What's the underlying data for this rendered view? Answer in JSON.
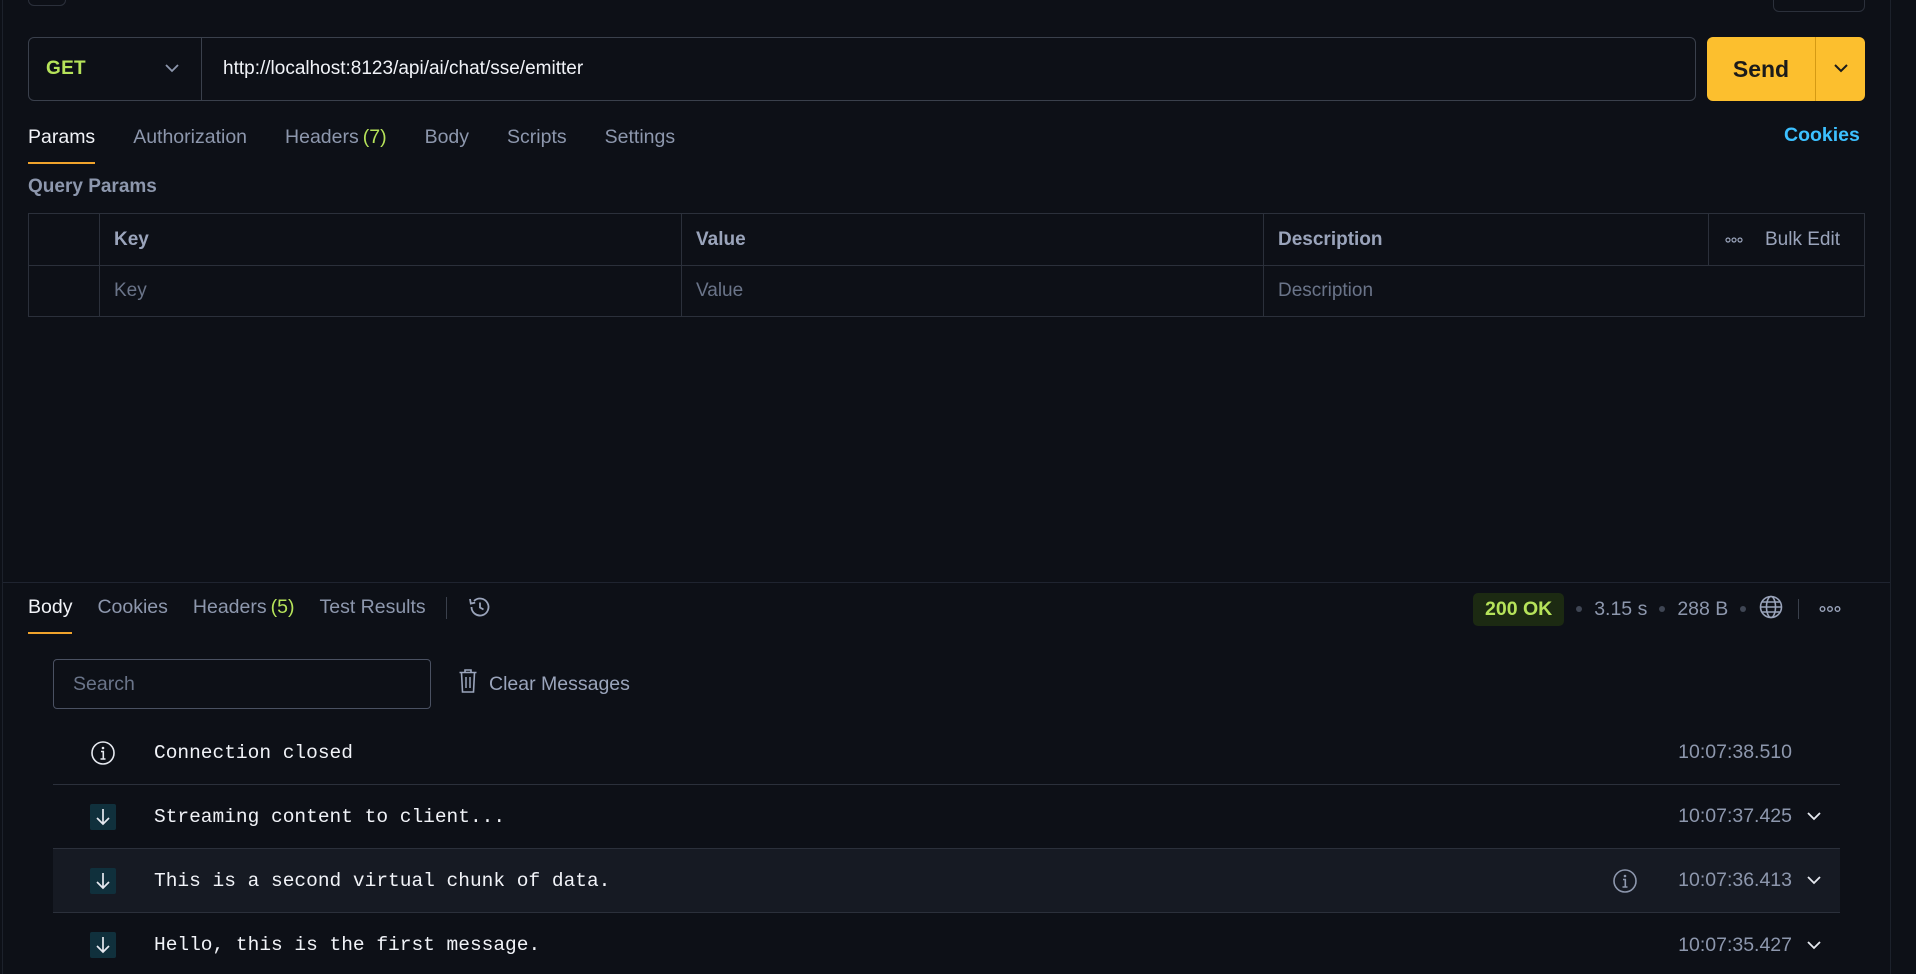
{
  "request": {
    "method": "GET",
    "url": "http://localhost:8123/api/ai/chat/sse/emitter",
    "send_label": "Send"
  },
  "request_tabs": {
    "params": "Params",
    "authorization": "Authorization",
    "headers": "Headers",
    "headers_count": "(7)",
    "body": "Body",
    "scripts": "Scripts",
    "settings": "Settings",
    "cookies": "Cookies"
  },
  "query_params": {
    "title": "Query Params",
    "headers": {
      "key": "Key",
      "value": "Value",
      "description": "Description",
      "bulk_edit": "Bulk Edit"
    },
    "placeholders": {
      "key": "Key",
      "value": "Value",
      "description": "Description"
    }
  },
  "response_tabs": {
    "body": "Body",
    "cookies": "Cookies",
    "headers": "Headers",
    "headers_count": "(5)",
    "test_results": "Test Results"
  },
  "response_meta": {
    "status": "200 OK",
    "time": "3.15 s",
    "size": "288 B"
  },
  "stream": {
    "search_placeholder": "Search",
    "clear_label": "Clear Messages",
    "messages": [
      {
        "type": "info",
        "text": "Connection closed",
        "time": "10:07:38.510"
      },
      {
        "type": "incoming",
        "text": "Streaming content to client...",
        "time": "10:07:37.425"
      },
      {
        "type": "incoming",
        "text": "This is a second virtual chunk of data.",
        "time": "10:07:36.413"
      },
      {
        "type": "incoming",
        "text": "Hello, this is the first message.",
        "time": "10:07:35.427"
      }
    ]
  },
  "colors": {
    "background": "#0d1017",
    "accent": "#fcbf2e",
    "method_get": "#b6e35a",
    "link": "#3cc0ff",
    "tab_underline": "#f0a32c"
  }
}
